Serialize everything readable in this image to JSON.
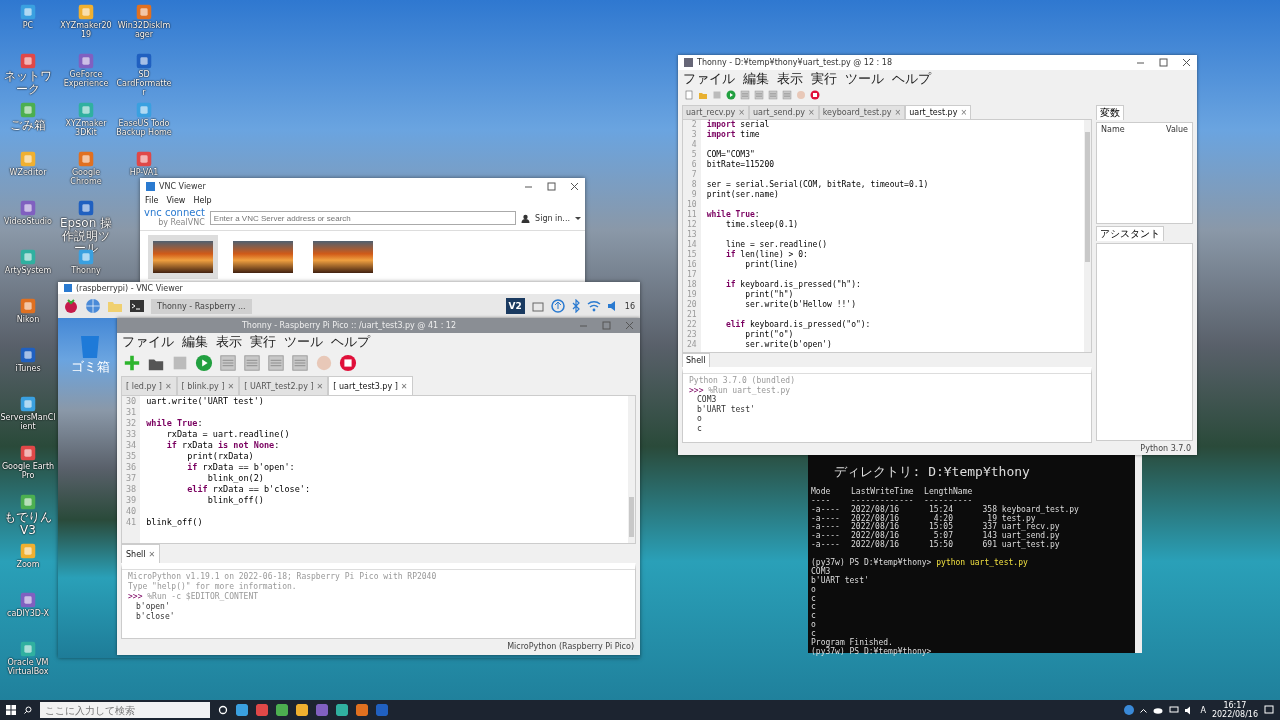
{
  "desktop": {
    "icon_columns": [
      [
        "PC",
        "ネットワーク",
        "ごみ箱",
        "WZeditor",
        "VideoStudio",
        "ArtySystem",
        "Nikon",
        "iTunes",
        "ServersManClient",
        "Google Earth Pro",
        "もでりんV3",
        "Zoom",
        "caDIY3D-X",
        "Oracle VM VirtualBox"
      ],
      [
        "XYZmaker2019",
        "GeForce Experience",
        "XYZmaker 3DKit",
        "Google Chrome",
        "Epson 操作説明ツール",
        "Thonny"
      ],
      [
        "Win32DiskImager",
        "SD CardFormatter",
        "EaseUS Todo Backup Home",
        "HP-VA1"
      ]
    ]
  },
  "vnc_viewer": {
    "title": "VNC Viewer",
    "menu": [
      "File",
      "View",
      "Help"
    ],
    "logo": "vnc connect",
    "logo_sub": "by RealVNC",
    "search": {
      "placeholder": "Enter a VNC Server address or search"
    },
    "sign_in": "Sign in...",
    "thumbnails": [
      {
        "selected": true
      },
      {
        "selected": false
      },
      {
        "selected": false
      }
    ]
  },
  "pi_window": {
    "title": "(raspberrypi) - VNC Viewer",
    "task": "Thonny - Raspberry ...",
    "vnc_badge": "V2",
    "clock": "16",
    "trash_label": "ゴミ箱",
    "thonny": {
      "title": "Thonny - Raspberry Pi Pico :: /uart_test3.py @ 41 : 12",
      "menu": [
        "ファイル",
        "編集",
        "表示",
        "実行",
        "ツール",
        "ヘルプ"
      ],
      "close_glyph": "✕",
      "tabs": [
        {
          "label": "[ led.py ]",
          "selected": false
        },
        {
          "label": "[ blink.py ]",
          "selected": false
        },
        {
          "label": "[ UART_test2.py ]",
          "selected": false
        },
        {
          "label": "[ uart_test3.py ]",
          "selected": true
        }
      ],
      "code": [
        {
          "n": "30",
          "text": "uart.write('UART test')"
        },
        {
          "n": "31"
        },
        {
          "n": "32",
          "text": "**while True**:"
        },
        {
          "n": "33",
          "text": "    rxData = uart.readline()"
        },
        {
          "n": "34",
          "text": "    **if** rxData **is not None**:"
        },
        {
          "n": "35",
          "text": "        print(rxData)"
        },
        {
          "n": "36",
          "text": "        **if** rxData == b'open':"
        },
        {
          "n": "37",
          "text": "            blink_on(2)"
        },
        {
          "n": "38",
          "text": "        **elif** rxData == b'close':"
        },
        {
          "n": "39",
          "text": "            blink_off()"
        },
        {
          "n": "40"
        },
        {
          "n": "41",
          "text": "blink_off()"
        }
      ],
      "shell_tab": "Shell",
      "banner": [
        "MicroPython v1.19.1 on 2022-06-18; Raspberry Pi Pico with RP2040",
        "Type \"help()\" for more information."
      ],
      "prompt": ">>>",
      "command": "%Run -c $EDITOR_CONTENT",
      "output": [
        "b'open'",
        "b'close'"
      ],
      "status": "MicroPython (Raspberry Pi Pico)"
    }
  },
  "thonny_pc": {
    "title": "Thonny - D:¥temp¥thony¥uart_test.py @ 12 : 18",
    "menu": [
      "ファイル",
      "編集",
      "表示",
      "実行",
      "ツール",
      "ヘルプ"
    ],
    "close_glyph": "×",
    "tabs": [
      {
        "label": "uart_recv.py",
        "selected": false
      },
      {
        "label": "uart_send.py",
        "selected": false
      },
      {
        "label": "keyboard_test.py",
        "selected": false
      },
      {
        "label": "uart_test.py",
        "selected": true
      }
    ],
    "code": [
      {
        "n": "2",
        "text": "**import** serial"
      },
      {
        "n": "3",
        "text": "**import** time"
      },
      {
        "n": "4"
      },
      {
        "n": "5",
        "text": "COM=\"COM3\""
      },
      {
        "n": "6",
        "text": "bitRate=115200"
      },
      {
        "n": "7"
      },
      {
        "n": "8",
        "text": "ser = serial.Serial(COM, bitRate, timeout=0.1)"
      },
      {
        "n": "9",
        "text": "print(ser.name)"
      },
      {
        "n": "10"
      },
      {
        "n": "11",
        "text": "**while True**:"
      },
      {
        "n": "12",
        "text": "    time.sleep(0.1)"
      },
      {
        "n": "13"
      },
      {
        "n": "14",
        "text": "    line = ser.readline()"
      },
      {
        "n": "15",
        "text": "    **if** len(line) > 0:"
      },
      {
        "n": "16",
        "text": "        print(line)"
      },
      {
        "n": "17"
      },
      {
        "n": "18",
        "text": "    **if** keyboard.is_pressed(\"h\"):"
      },
      {
        "n": "19",
        "text": "        print(\"h\")"
      },
      {
        "n": "20",
        "text": "        ser.write(b'Hellow !!')"
      },
      {
        "n": "21"
      },
      {
        "n": "22",
        "text": "    **elif** keyboard.is_pressed(\"o\"):"
      },
      {
        "n": "23",
        "text": "        print(\"o\")"
      },
      {
        "n": "24",
        "text": "        ser.write(b'open')"
      }
    ],
    "variables": {
      "title": "変数",
      "columns": [
        "Name",
        "Value"
      ]
    },
    "assistant": "アシスタント",
    "shell_tab": "Shell",
    "banner": [
      "Python 3.7.0 (bundled)"
    ],
    "prompt": ">>>",
    "command": "%Run uart_test.py",
    "output": [
      "COM3",
      "b'UART test'",
      "o",
      "c"
    ],
    "status": "Python 3.7.0"
  },
  "terminal": {
    "directory": "ディレクトリ: D:¥temp¥thony",
    "headers": [
      "Mode",
      "LastWriteTime",
      "Length",
      "Name"
    ],
    "dashes": [
      "----",
      "-------------",
      "------",
      "----"
    ],
    "rows": [
      {
        "mode": "-a----",
        "date": "2022/08/16",
        "time": "15:24",
        "length": "358",
        "name": "keyboard_test.py"
      },
      {
        "mode": "-a----",
        "date": "2022/08/16",
        "time": "4:20",
        "length": "19",
        "name": "test.py"
      },
      {
        "mode": "-a----",
        "date": "2022/08/16",
        "time": "15:05",
        "length": "337",
        "name": "uart_recv.py"
      },
      {
        "mode": "-a----",
        "date": "2022/08/16",
        "time": "5:07",
        "length": "143",
        "name": "uart_send.py"
      },
      {
        "mode": "-a----",
        "date": "2022/08/16",
        "time": "15:50",
        "length": "691",
        "name": "uart_test.py"
      }
    ],
    "prompt": "(py37w) PS D:¥temp¥thony>",
    "command": "python uart_test.py",
    "output": [
      "COM3",
      "b'UART test'",
      "o",
      "c",
      "c",
      "c",
      "o",
      "c",
      "Program Finished."
    ],
    "prompt2": "(py37w) PS D:¥temp¥thony>"
  },
  "taskbar": {
    "search": {
      "placeholder": "ここに入力して検索"
    },
    "ime": "A",
    "time": "16:17",
    "date": "2022/08/16"
  }
}
